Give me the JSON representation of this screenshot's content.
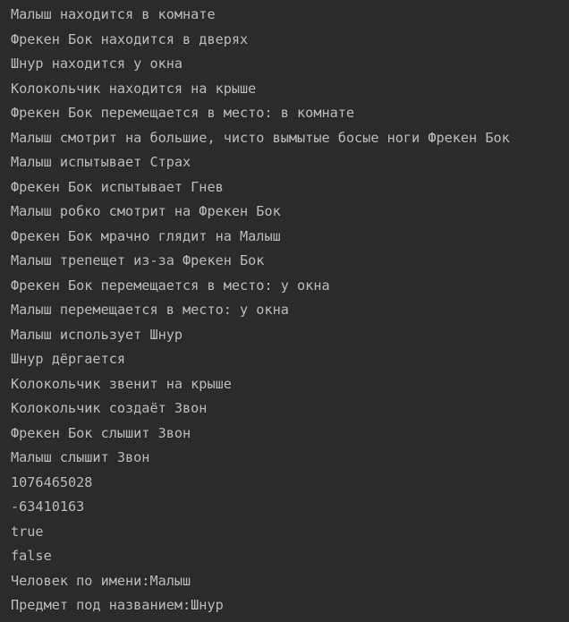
{
  "console": {
    "lines": [
      "Малыш находится в комнате",
      "Фрекен Бок находится в дверях",
      "Шнур находится у окна",
      "Колокольчик находится на крыше",
      "Фрекен Бок перемещается в место: в комнате",
      "Малыш смотрит на большие, чисто вымытые босые ноги Фрекен Бок",
      "Малыш испытывает Страх",
      "Фрекен Бок испытывает Гнев",
      "Малыш робко смотрит на Фрекен Бок",
      "Фрекен Бок мрачно глядит на Малыш",
      "Малыш трепещет из-за Фрекен Бок",
      "Фрекен Бок перемещается в место: у окна",
      "Малыш перемещается в место: у окна",
      "Малыш использует Шнур",
      "Шнур дёргается",
      "Колокольчик звенит на крыше",
      "Колокольчик создаёт Звон",
      "Фрекен Бок слышит Звон",
      "Малыш слышит Звон",
      "1076465028",
      "-63410163",
      "true",
      "false",
      "Человек по имени:Малыш",
      "Предмет под названием:Шнур"
    ]
  },
  "colors": {
    "background": "#2b2b2b",
    "text": "#bbbbbb"
  }
}
